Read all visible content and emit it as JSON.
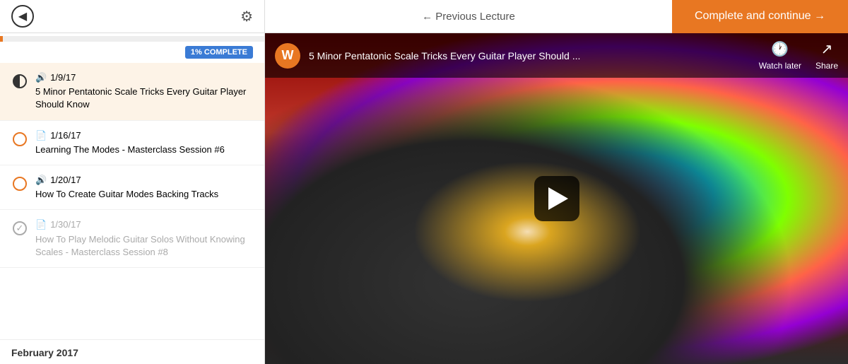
{
  "header": {
    "back_label": "←",
    "previous_lecture_label": "← Previous Lecture",
    "complete_continue_label": "Complete and continue →",
    "gear_icon": "⚙"
  },
  "sidebar": {
    "progress_percent": 1,
    "progress_label": "1% COMPLETE",
    "items": [
      {
        "id": "item-1",
        "date_icon": "🔊",
        "date": "1/9/17",
        "title": "5 Minor Pentatonic Scale Tricks Every Guitar Player Should Know",
        "state": "active"
      },
      {
        "id": "item-2",
        "date_icon": "📄",
        "date": "1/16/17",
        "title": "Learning The Modes - Masterclass Session #6",
        "state": "incomplete"
      },
      {
        "id": "item-3",
        "date_icon": "🔊",
        "date": "1/20/17",
        "title": "How To Create Guitar Modes Backing Tracks",
        "state": "incomplete"
      },
      {
        "id": "item-4",
        "date_icon": "📄",
        "date": "1/30/17",
        "title": "How To Play Melodic Guitar Solos Without Knowing Scales - Masterclass Session #8",
        "state": "dimmed"
      }
    ],
    "month_label": "February 2017"
  },
  "video": {
    "logo_text": "W",
    "title": "5 Minor Pentatonic Scale Tricks Every Guitar Player Should ...",
    "watch_later_label": "Watch later",
    "share_label": "Share",
    "clock_icon": "🕐",
    "share_icon": "↗"
  }
}
